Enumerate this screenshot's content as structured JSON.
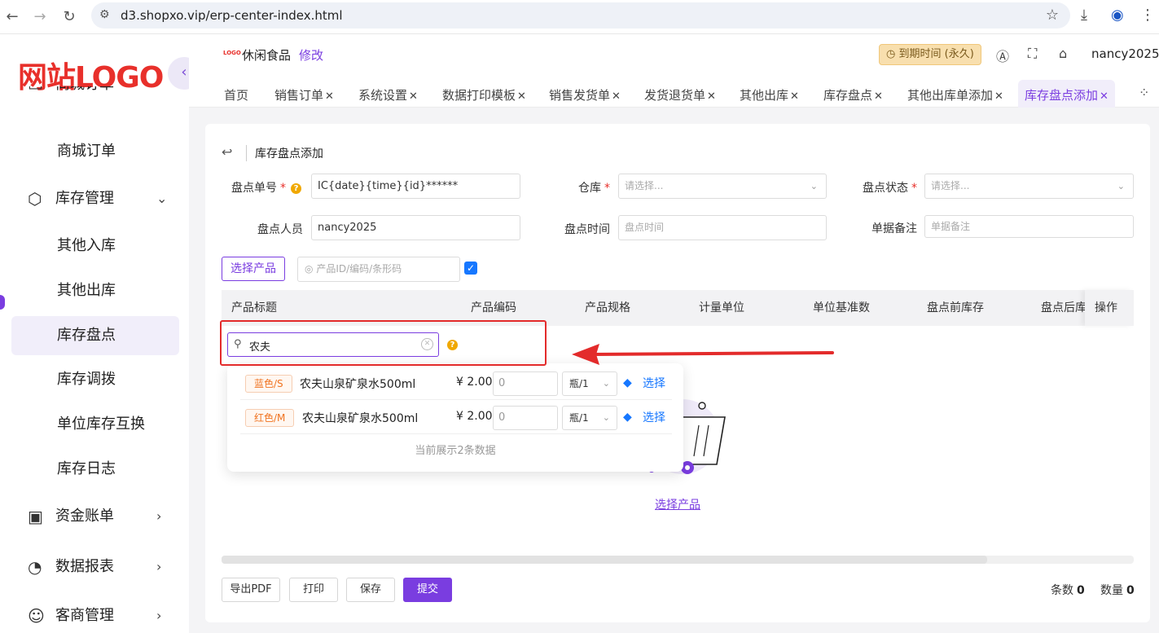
{
  "browser": {
    "url": "d3.shopxo.vip/erp-center-index.html"
  },
  "sidebar": {
    "logo": "网站LOGO",
    "items": [
      {
        "label": "商城订单",
        "type": "group-cut"
      },
      {
        "label": "商城订单",
        "type": "sub"
      },
      {
        "label": "库存管理",
        "type": "group"
      },
      {
        "label": "其他入库",
        "type": "sub"
      },
      {
        "label": "其他出库",
        "type": "sub"
      },
      {
        "label": "库存盘点",
        "type": "sub"
      },
      {
        "label": "库存调拨",
        "type": "sub"
      },
      {
        "label": "单位库存互换",
        "type": "sub"
      },
      {
        "label": "库存日志",
        "type": "sub"
      },
      {
        "label": "资金账单",
        "type": "group"
      },
      {
        "label": "数据报表",
        "type": "group"
      },
      {
        "label": "客商管理",
        "type": "group"
      }
    ]
  },
  "header": {
    "shop_logo": "LOGO",
    "shop_name": "休闲食品",
    "edit_label": "修改",
    "expire_label": "到期时间 (永久)",
    "username": "nancy2025"
  },
  "tabs": [
    {
      "label": "首页",
      "closable": false
    },
    {
      "label": "销售订单",
      "closable": true
    },
    {
      "label": "系统设置",
      "closable": true
    },
    {
      "label": "数据打印模板",
      "closable": true
    },
    {
      "label": "销售发货单",
      "closable": true
    },
    {
      "label": "发货退货单",
      "closable": true
    },
    {
      "label": "其他出库",
      "closable": true
    },
    {
      "label": "库存盘点",
      "closable": true
    },
    {
      "label": "其他出库单添加",
      "closable": true
    },
    {
      "label": "库存盘点添加",
      "closable": true,
      "active": true
    }
  ],
  "page": {
    "title": "库存盘点添加"
  },
  "form": {
    "order_no_label": "盘点单号",
    "order_no_value": "IC{date}{time}{id}******",
    "warehouse_label": "仓库",
    "warehouse_placeholder": "请选择...",
    "status_label": "盘点状态",
    "status_placeholder": "请选择...",
    "staff_label": "盘点人员",
    "staff_value": "nancy2025",
    "time_label": "盘点时间",
    "time_placeholder": "盘点时间",
    "remark_label": "单据备注",
    "remark_placeholder": "单据备注"
  },
  "product_bar": {
    "select_button": "选择产品",
    "search_placeholder": "产品ID/编码/条形码",
    "checkbox_checked": true
  },
  "table": {
    "columns": [
      "产品标题",
      "产品编码",
      "产品规格",
      "计量单位",
      "单位基准数",
      "盘点前库存",
      "盘点后库",
      "操作"
    ],
    "empty_link": "选择产品"
  },
  "search_popup": {
    "query": "农夫",
    "rows": [
      {
        "tag": "蓝色/S",
        "name": "农夫山泉矿泉水500ml",
        "price": "¥ 2.00",
        "qty": "0",
        "unit": "瓶/1",
        "action": "选择"
      },
      {
        "tag": "红色/M",
        "name": "农夫山泉矿泉水500ml",
        "price": "¥ 2.00",
        "qty": "0",
        "unit": "瓶/1",
        "action": "选择"
      }
    ],
    "footer": "当前展示2条数据"
  },
  "footer": {
    "export_pdf": "导出PDF",
    "print": "打印",
    "save": "保存",
    "submit": "提交",
    "count_label": "条数",
    "count_value": "0",
    "qty_label": "数量",
    "qty_value": "0"
  },
  "colors": {
    "accent": "#7a3de0",
    "logo_red": "#e8302b",
    "highlight_red": "#e32b2b",
    "link_blue": "#1677ff"
  }
}
